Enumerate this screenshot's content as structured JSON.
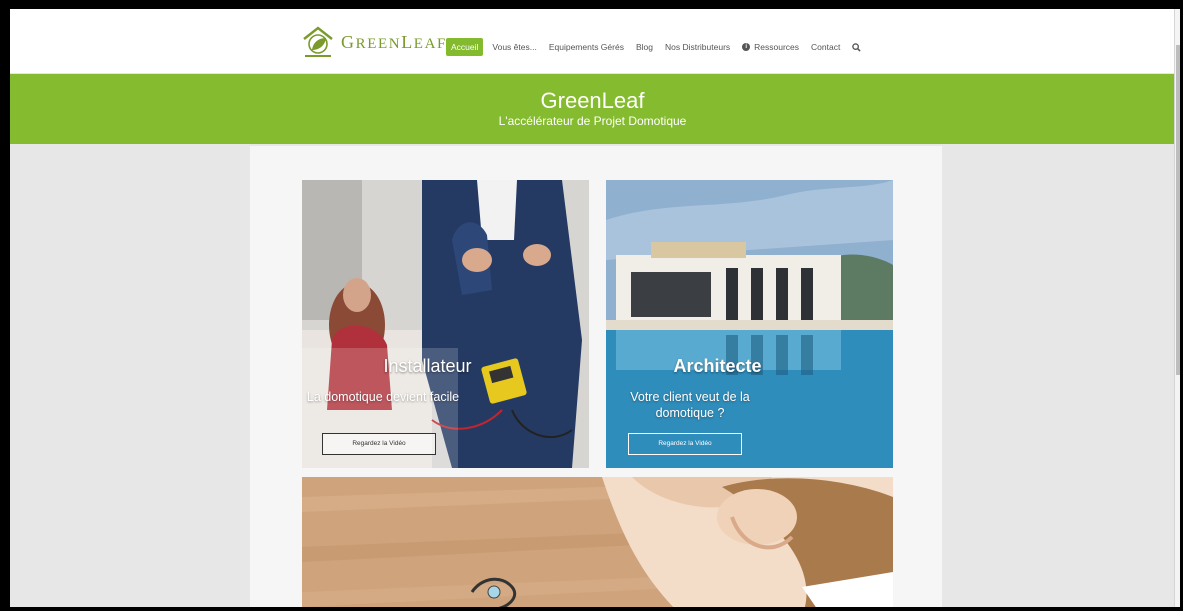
{
  "header": {
    "logo_text": "GreenLeaf",
    "nav": [
      {
        "label": "Accueil",
        "active": true
      },
      {
        "label": "Vous êtes...",
        "active": false
      },
      {
        "label": "Equipements Gérés",
        "active": false
      },
      {
        "label": "Blog",
        "active": false
      },
      {
        "label": "Nos Distributeurs",
        "active": false
      },
      {
        "label": "Ressources",
        "active": false,
        "icon": "info-icon"
      },
      {
        "label": "Contact",
        "active": false
      }
    ],
    "search_icon": "search-icon"
  },
  "banner": {
    "title": "GreenLeaf",
    "subtitle": "L'accélérateur de Projet Domotique"
  },
  "tiles": [
    {
      "title": "Installateur",
      "text": "La domotique devient facile",
      "button": "Regardez la Vidéo"
    },
    {
      "title": "Architecte",
      "text": "Votre client veut de la domotique ?",
      "button": "Regardez la Vidéo"
    }
  ],
  "colors": {
    "brand_green": "#85bb2f",
    "logo_green": "#7a9a2c"
  }
}
